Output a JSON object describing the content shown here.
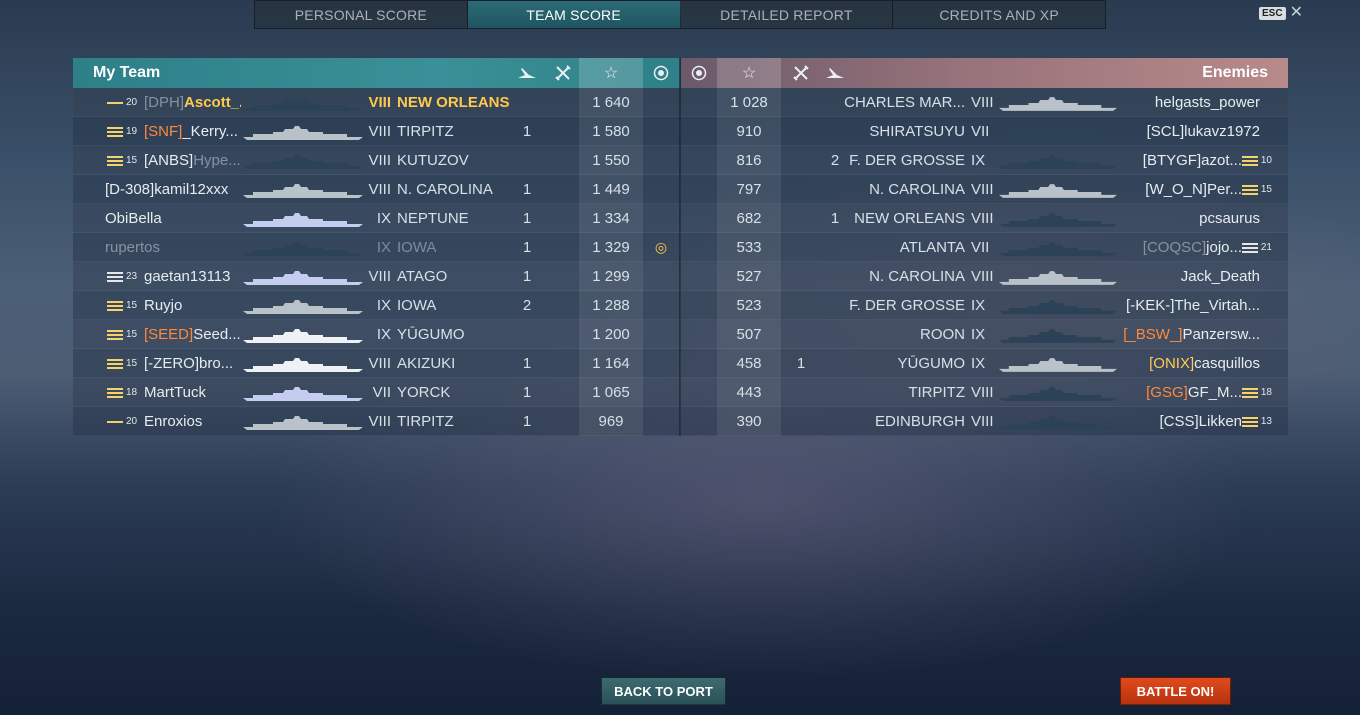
{
  "tabs": [
    {
      "label": "PERSONAL SCORE",
      "active": false
    },
    {
      "label": "TEAM SCORE",
      "active": true
    },
    {
      "label": "DETAILED REPORT",
      "active": false
    },
    {
      "label": "CREDITS AND XP",
      "active": false
    }
  ],
  "esc_label": "ESC",
  "my_team": {
    "title": "My Team",
    "rows": [
      {
        "rank_badge": "one",
        "rank": "20",
        "clan": "[DPH]",
        "clan_color": "dim",
        "player": "Ascott_...",
        "player_style": "yellow",
        "tier": "VIII",
        "ship": "NEW ORLEANS",
        "ship_style": "yellow",
        "kills": "",
        "score": "1 640",
        "medal": false,
        "sil": "dark"
      },
      {
        "rank_badge": "gold2",
        "rank": "19",
        "clan": "[SNF]",
        "clan_color": "orange",
        "player": "_Kerry...",
        "player_style": "",
        "tier": "VIII",
        "ship": "TIRPITZ",
        "ship_style": "",
        "kills": "1",
        "score": "1 580",
        "medal": false,
        "sil": "light"
      },
      {
        "rank_badge": "gold",
        "rank": "15",
        "clan": "[ANBS]",
        "clan_color": "",
        "player": "Hype...",
        "player_style": "dim",
        "tier": "VIII",
        "ship": "KUTUZOV",
        "ship_style": "",
        "kills": "",
        "score": "1 550",
        "medal": false,
        "sil": "dark"
      },
      {
        "rank_badge": "none",
        "rank": "",
        "clan": "[D-308]",
        "clan_color": "",
        "player": "kamil12xxx",
        "player_style": "",
        "tier": "VIII",
        "ship": "N. CAROLINA",
        "ship_style": "",
        "kills": "1",
        "score": "1 449",
        "medal": false,
        "sil": "light"
      },
      {
        "rank_badge": "none",
        "rank": "",
        "clan": "",
        "clan_color": "",
        "player": "ObiBella",
        "player_style": "",
        "tier": "IX",
        "ship": "NEPTUNE",
        "ship_style": "",
        "kills": "1",
        "score": "1 334",
        "medal": false,
        "sil": "blue"
      },
      {
        "rank_badge": "none",
        "rank": "",
        "clan": "",
        "clan_color": "",
        "player": "rupertos",
        "player_style": "dim",
        "tier": "IX",
        "ship": "IOWA",
        "ship_style": "dim",
        "kills": "1",
        "score": "1 329",
        "medal": true,
        "sil": "dark"
      },
      {
        "rank_badge": "white",
        "rank": "23",
        "clan": "",
        "clan_color": "",
        "player": "gaetan13113",
        "player_style": "",
        "tier": "VIII",
        "ship": "ATAGO",
        "ship_style": "",
        "kills": "1",
        "score": "1 299",
        "medal": false,
        "sil": "blue"
      },
      {
        "rank_badge": "gold",
        "rank": "15",
        "clan": "",
        "clan_color": "",
        "player": "Ruyjo",
        "player_style": "",
        "tier": "IX",
        "ship": "IOWA",
        "ship_style": "",
        "kills": "2",
        "score": "1 288",
        "medal": false,
        "sil": "light"
      },
      {
        "rank_badge": "gold",
        "rank": "15",
        "clan": "[SEED]",
        "clan_color": "orange",
        "player": "Seed...",
        "player_style": "",
        "tier": "IX",
        "ship": "YŪGUMO",
        "ship_style": "",
        "kills": "",
        "score": "1 200",
        "medal": false,
        "sil": "white"
      },
      {
        "rank_badge": "gold",
        "rank": "15",
        "clan": "[-ZERO]",
        "clan_color": "",
        "player": "bro...",
        "player_style": "",
        "tier": "VIII",
        "ship": "AKIZUKI",
        "ship_style": "",
        "kills": "1",
        "score": "1 164",
        "medal": false,
        "sil": "white"
      },
      {
        "rank_badge": "gold2",
        "rank": "18",
        "clan": "",
        "clan_color": "",
        "player": "MartTuck",
        "player_style": "",
        "tier": "VII",
        "ship": "YORCK",
        "ship_style": "",
        "kills": "1",
        "score": "1 065",
        "medal": false,
        "sil": "blue"
      },
      {
        "rank_badge": "one",
        "rank": "20",
        "clan": "",
        "clan_color": "",
        "player": "Enroxios",
        "player_style": "",
        "tier": "VIII",
        "ship": "TIRPITZ",
        "ship_style": "",
        "kills": "1",
        "score": "969",
        "medal": false,
        "sil": "light"
      }
    ]
  },
  "enemies": {
    "title": "Enemies",
    "rows": [
      {
        "score": "1 028",
        "kills": "",
        "planes": "",
        "ship": "CHARLES MAR...",
        "tier": "VIII",
        "clan": "",
        "clan_color": "",
        "player": "helgasts_power",
        "rank_badge": "none",
        "rank": ""
      },
      {
        "score": "910",
        "kills": "",
        "planes": "",
        "ship": "SHIRATSUYU",
        "tier": "VII",
        "clan": "[SCL]",
        "clan_color": "",
        "player": "lukavz1972",
        "rank_badge": "none",
        "rank": ""
      },
      {
        "score": "816",
        "kills": "2",
        "planes": "",
        "ship": "F. DER GROßE",
        "tier": "IX",
        "clan": "[BTYGF]",
        "clan_color": "",
        "player": "azot...",
        "rank_badge": "gold",
        "rank": "10"
      },
      {
        "score": "797",
        "kills": "",
        "planes": "",
        "ship": "N. CAROLINA",
        "tier": "VIII",
        "clan": "[W_O_N]",
        "clan_color": "",
        "player": "Per...",
        "rank_badge": "gold",
        "rank": "15"
      },
      {
        "score": "682",
        "kills": "1",
        "planes": "",
        "ship": "NEW ORLEANS",
        "tier": "VIII",
        "clan": "",
        "clan_color": "",
        "player": "pcsaurus",
        "rank_badge": "none",
        "rank": ""
      },
      {
        "score": "533",
        "kills": "",
        "planes": "",
        "ship": "ATLANTA",
        "tier": "VII",
        "clan": "[COQSC]",
        "clan_color": "dim",
        "player": "jojo...",
        "rank_badge": "white",
        "rank": "21"
      },
      {
        "score": "527",
        "kills": "",
        "planes": "",
        "ship": "N. CAROLINA",
        "tier": "VIII",
        "clan": "",
        "clan_color": "",
        "player": "Jack_Death",
        "rank_badge": "none",
        "rank": ""
      },
      {
        "score": "523",
        "kills": "",
        "planes": "",
        "ship": "F. DER GROßE",
        "tier": "IX",
        "clan": "[-KEK-]",
        "clan_color": "",
        "player": "The_Virtah...",
        "rank_badge": "none",
        "rank": ""
      },
      {
        "score": "507",
        "kills": "",
        "planes": "",
        "ship": "ROON",
        "tier": "IX",
        "clan": "[_BSW_]",
        "clan_color": "orange",
        "player": "Panzersw...",
        "rank_badge": "none",
        "rank": ""
      },
      {
        "score": "458",
        "kills": "",
        "planes": "1",
        "ship": "YŪGUMO",
        "tier": "IX",
        "clan": "[ONIX]",
        "clan_color": "gold",
        "player": "casquillos",
        "rank_badge": "none",
        "rank": ""
      },
      {
        "score": "443",
        "kills": "",
        "planes": "",
        "ship": "TIRPITZ",
        "tier": "VIII",
        "clan": "[GSG]",
        "clan_color": "orange",
        "player": "GF_M...",
        "rank_badge": "gold2",
        "rank": "18"
      },
      {
        "score": "390",
        "kills": "",
        "planes": "",
        "ship": "EDINBURGH",
        "tier": "VIII",
        "clan": "[CSS]",
        "clan_color": "",
        "player": "Likken",
        "rank_badge": "gold",
        "rank": "13"
      }
    ]
  },
  "buttons": {
    "back_to_port": "BACK TO PORT",
    "battle": "BATTLE ON!"
  },
  "colors": {
    "accent_teal": "#2d7f88",
    "enemy_header": "#b88a8a",
    "highlight_yellow": "#ffc94d",
    "clan_orange": "#ff8a3c",
    "battle_button": "#d8401a"
  }
}
